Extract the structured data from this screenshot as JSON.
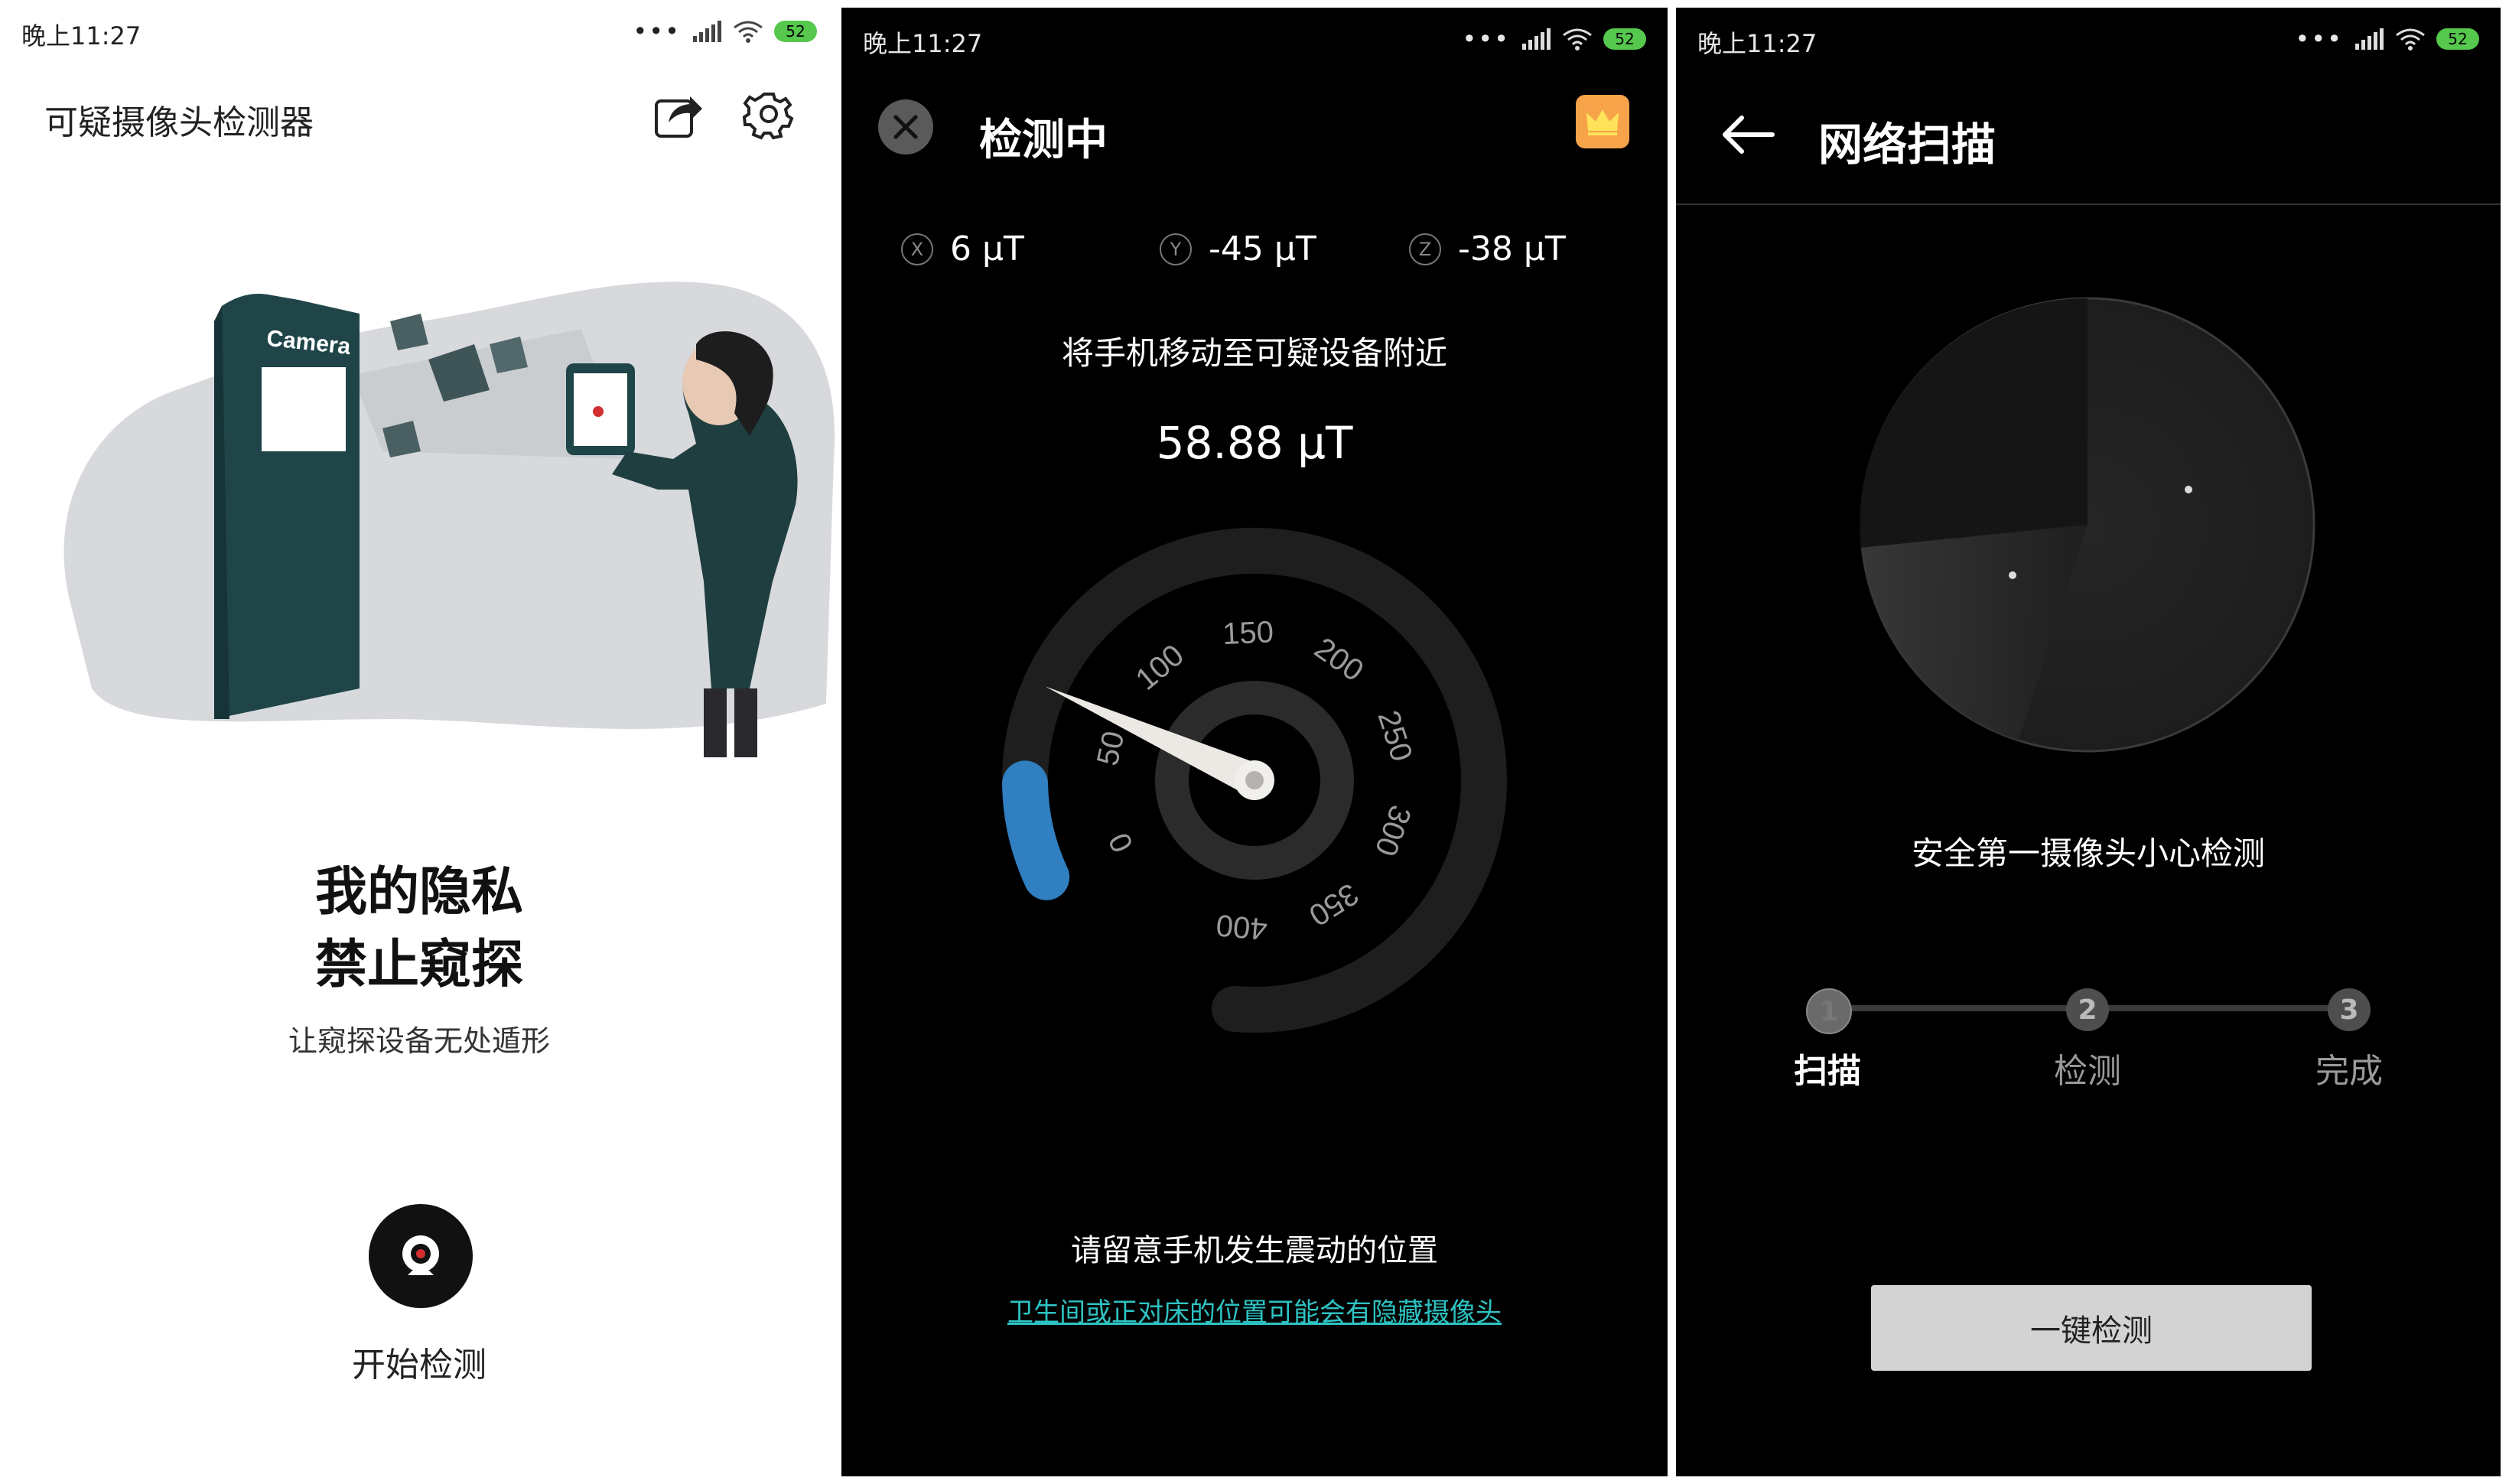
{
  "status": {
    "time": "晚上11:27",
    "battery": "52"
  },
  "screen1": {
    "title": "可疑摄像头检测器",
    "illustration_text": "Camera",
    "headline_line1": "我的隐私",
    "headline_line2": "禁止窥探",
    "subtitle": "让窥探设备无处遁形",
    "start_label": "开始检测"
  },
  "screen2": {
    "title": "检测中",
    "axes": [
      {
        "badge": "X",
        "value": "6 μT"
      },
      {
        "badge": "Y",
        "value": "-45 μT"
      },
      {
        "badge": "Z",
        "value": "-38 μT"
      }
    ],
    "hint": "将手机移动至可疑设备附近",
    "reading": "58.88 μT",
    "gauge": {
      "ticks": [
        "0",
        "50",
        "100",
        "150",
        "200",
        "250",
        "300",
        "350",
        "400"
      ],
      "max": 400,
      "value": 58.88,
      "fill_color": "#2f7fc1"
    },
    "note": "请留意手机发生震动的位置",
    "link": "卫生间或正对床的位置可能会有隐藏摄像头"
  },
  "screen3": {
    "title": "网络扫描",
    "caption": "安全第一摄像头小心检测",
    "steps": [
      {
        "num": "1",
        "label": "扫描",
        "active": true
      },
      {
        "num": "2",
        "label": "检测",
        "active": false
      },
      {
        "num": "3",
        "label": "完成",
        "active": false
      }
    ],
    "button_label": "一键检测"
  }
}
